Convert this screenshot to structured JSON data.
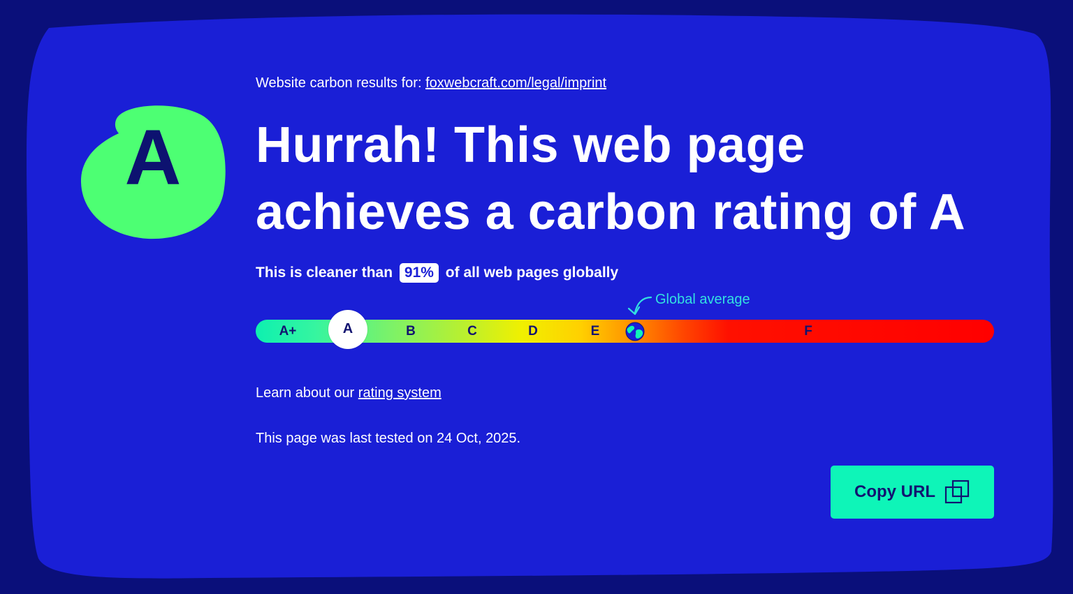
{
  "colors": {
    "page_bg": "#0a0f7a",
    "card_bg": "#1a1fd6",
    "grade_blob": "#4dff73",
    "accent_teal": "#0ef5b8",
    "global_avg_text": "#33e0e0",
    "dark_text": "#121470"
  },
  "header": {
    "results_prefix": "Website carbon results for:",
    "results_url": "foxwebcraft.com/legal/imprint"
  },
  "grade": {
    "letter": "A"
  },
  "headline": {
    "line1": "Hurrah! This web page",
    "line2": "achieves a carbon rating of A"
  },
  "summary": {
    "prefix": "This is cleaner than",
    "percent": "91%",
    "suffix": "of all web pages globally"
  },
  "rating_scale": {
    "global_average_label": "Global average",
    "labels": [
      "A+",
      "A",
      "B",
      "C",
      "D",
      "E",
      "F"
    ],
    "current": "A",
    "global_average_marker_icon": "globe-icon"
  },
  "learn": {
    "prefix": "Learn about our",
    "link": "rating system"
  },
  "tested": {
    "text": "This page was last tested on 24 Oct, 2025."
  },
  "actions": {
    "copy_label": "Copy URL",
    "copy_icon": "copy-icon"
  }
}
